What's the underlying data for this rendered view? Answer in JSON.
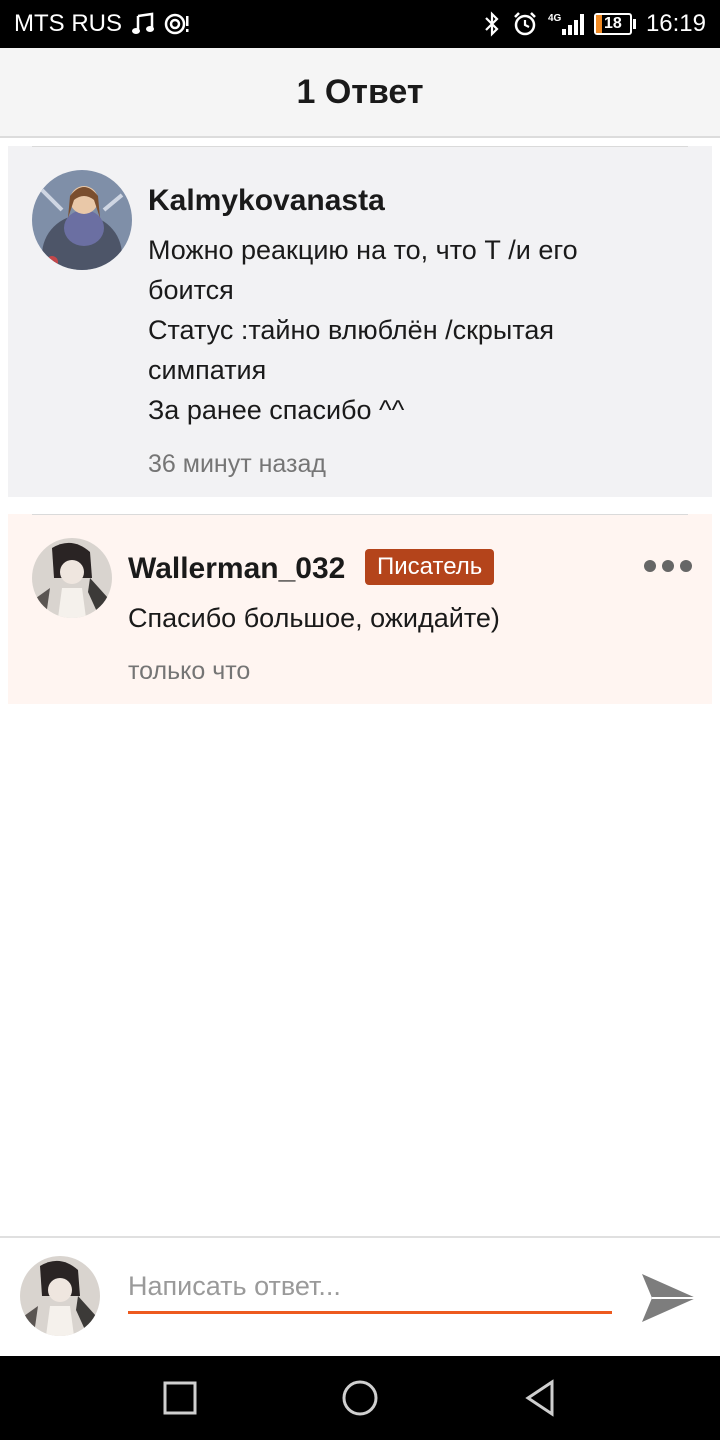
{
  "status_bar": {
    "carrier": "MTS RUS",
    "network": "4G",
    "battery": "18",
    "battery_level": 0.18,
    "time": "16:19",
    "icons": [
      "music-note-icon",
      "hotspot-icon",
      "bluetooth-icon",
      "alarm-icon",
      "signal-icon",
      "battery-icon"
    ]
  },
  "header": {
    "title": "1 Ответ"
  },
  "comments": [
    {
      "author": "Kalmykovanasta",
      "lines": [
        "Можно реакцию на то, что Т /и его",
        "боится",
        "Статус :тайно влюблён /скрытая",
        "симпатия",
        "За ранее спасибо ^^"
      ],
      "time": "36 минут назад"
    },
    {
      "author": "Wallerman_032",
      "badge": "Писатель",
      "text": "Спасибо большое, ожидайте)",
      "time": "только что"
    }
  ],
  "reply": {
    "placeholder": "Написать ответ..."
  },
  "colors": {
    "accent": "#ed5a1f",
    "badge": "#b4441b",
    "reply_bg": "#fff5f1",
    "comment_bg": "#f2f2f4"
  }
}
